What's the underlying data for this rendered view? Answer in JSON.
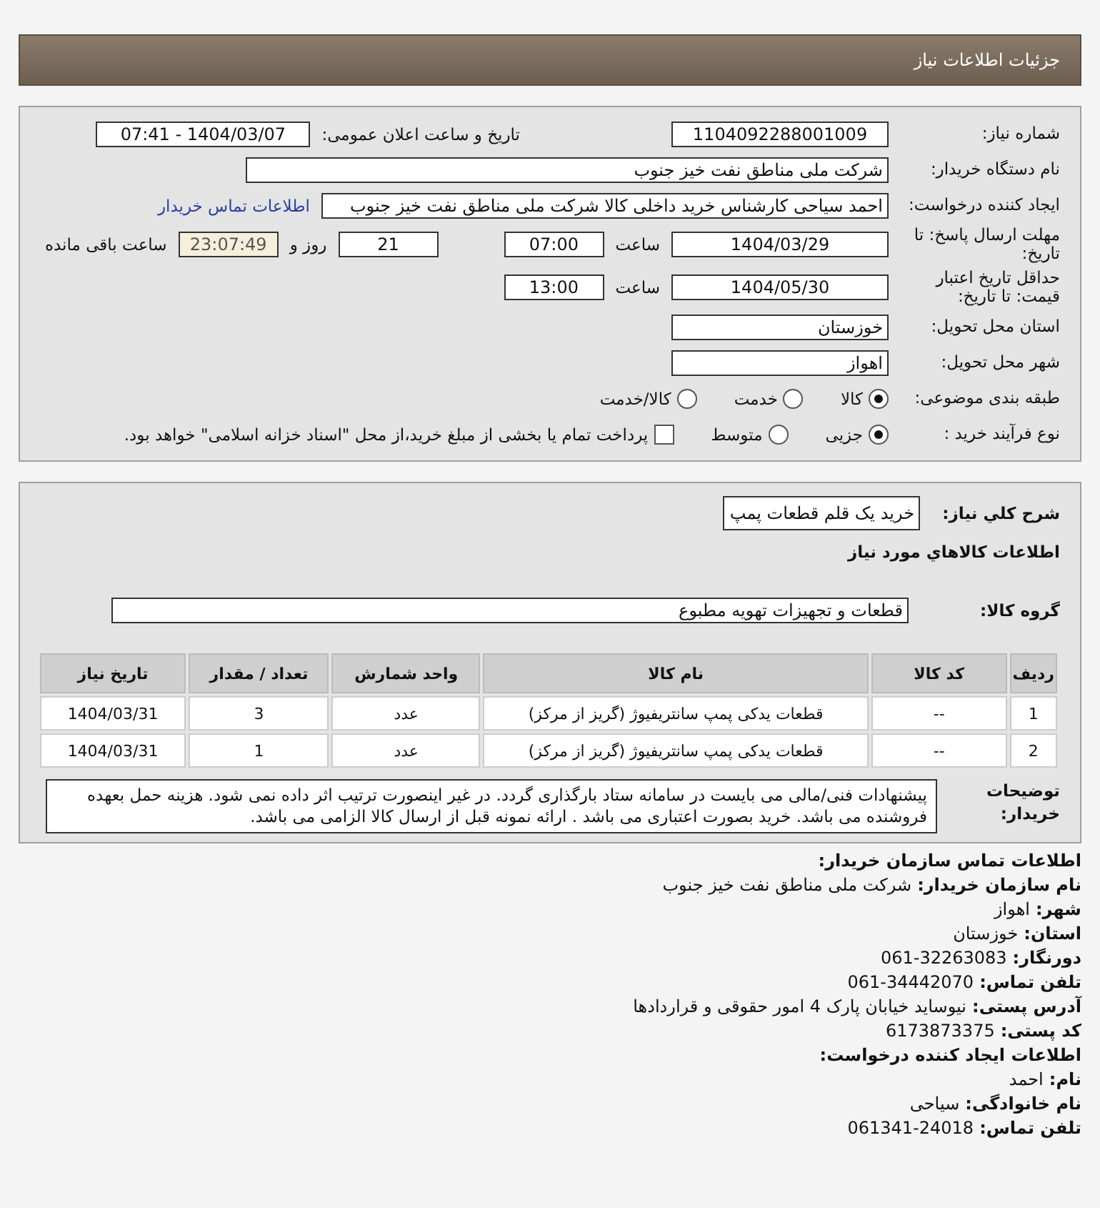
{
  "header": {
    "title": "جزئیات اطلاعات نیاز"
  },
  "need_number": {
    "label": "شماره نیاز:",
    "value": "1104092288001009"
  },
  "announce": {
    "label": "تاریخ و ساعت اعلان عمومی:",
    "value": "1404/03/07 - 07:41"
  },
  "buyer_org": {
    "label": "نام دستگاه خریدار:",
    "value": "شرکت ملی مناطق نفت خیز جنوب"
  },
  "requester": {
    "label": "ایجاد کننده درخواست:",
    "value": "احمد  سیاحی  کارشناس خرید داخلی کالا شرکت ملی مناطق نفت خیز جنوب",
    "link": "اطلاعات تماس خریدار"
  },
  "deadline": {
    "label": "مهلت ارسال پاسخ: تا تاریخ:",
    "date": "1404/03/29",
    "time_label": "ساعت",
    "time": "07:00",
    "days": "21",
    "days_label": "روز و",
    "remaining": "23:07:49",
    "remaining_label": "ساعت باقی مانده"
  },
  "validity": {
    "label": "حداقل تاریخ اعتبار قیمت: تا تاریخ:",
    "date": "1404/05/30",
    "time_label": "ساعت",
    "time": "13:00"
  },
  "province": {
    "label": "استان محل تحویل:",
    "value": "خوزستان"
  },
  "city": {
    "label": "شهر محل تحویل:",
    "value": "اهواز"
  },
  "category": {
    "label": "طبقه بندی موضوعی:",
    "options": [
      {
        "label": "کالا",
        "selected": true
      },
      {
        "label": "خدمت",
        "selected": false
      },
      {
        "label": "کالا/خدمت",
        "selected": false
      }
    ]
  },
  "process": {
    "label": "نوع فرآیند خرید :",
    "options": [
      {
        "label": "جزیی",
        "selected": true
      },
      {
        "label": "متوسط",
        "selected": false
      }
    ],
    "checkbox": {
      "label": "پرداخت تمام یا بخشی از مبلغ خرید،از محل \"اسناد خزانه اسلامی\" خواهد بود.",
      "checked": false
    }
  },
  "summary": {
    "label": "شرح کلي نياز:",
    "value": "خرید یک قلم قطعات پمپ"
  },
  "goods_title": "اطلاعات کالاهاي مورد نياز",
  "group": {
    "label": "گروه کالا:",
    "value": "قطعات و تجهیزات تهویه مطبوع"
  },
  "table": {
    "columns": [
      "ردیف",
      "کد کالا",
      "نام کالا",
      "واحد شمارش",
      "تعداد / مقدار",
      "تاریخ نیاز"
    ],
    "rows": [
      [
        "1",
        "--",
        "قطعات یدکی پمپ سانتریفیوژ (گریز از مرکز)",
        "عدد",
        "3",
        "1404/03/31"
      ],
      [
        "2",
        "--",
        "قطعات یدکی پمپ سانتریفیوژ (گریز از مرکز)",
        "عدد",
        "1",
        "1404/03/31"
      ]
    ]
  },
  "notes": {
    "label": "توضیحات خریدار:",
    "text": "پیشنهادات فنی/مالی می بایست در سامانه ستاد بارگذاری گردد. در غیر اینصورت ترتیب اثر داده نمی شود. هزینه حمل بعهده فروشنده می باشد. خرید بصورت اعتباری می باشد . ارائه نمونه قبل از ارسال کالا الزامی می باشد."
  },
  "contact": [
    {
      "kind": "heading",
      "label": "اطلاعات تماس سازمان خریدار:"
    },
    {
      "kind": "field",
      "label": "نام سازمان خریدار:",
      "value": "شرکت ملی مناطق نفت خیز جنوب"
    },
    {
      "kind": "field",
      "label": "شهر:",
      "value": "اهواز"
    },
    {
      "kind": "field",
      "label": "استان:",
      "value": "خوزستان"
    },
    {
      "kind": "field",
      "label": "دورنگار:",
      "value": "061-32263083"
    },
    {
      "kind": "field",
      "label": "تلفن تماس:",
      "value": "061-34442070"
    },
    {
      "kind": "field",
      "label": "آدرس پستی:",
      "value": "نیوساید خیابان پارک 4 امور حقوقی و قراردادها"
    },
    {
      "kind": "field",
      "label": "کد پستی:",
      "value": "6173873375"
    },
    {
      "kind": "heading",
      "label": "اطلاعات ایجاد کننده درخواست:"
    },
    {
      "kind": "field",
      "label": "نام:",
      "value": "احمد"
    },
    {
      "kind": "field",
      "label": "نام خانوادگی:",
      "value": "سیاحی"
    },
    {
      "kind": "field",
      "label": "تلفن تماس:",
      "value": "061341-24018"
    }
  ]
}
